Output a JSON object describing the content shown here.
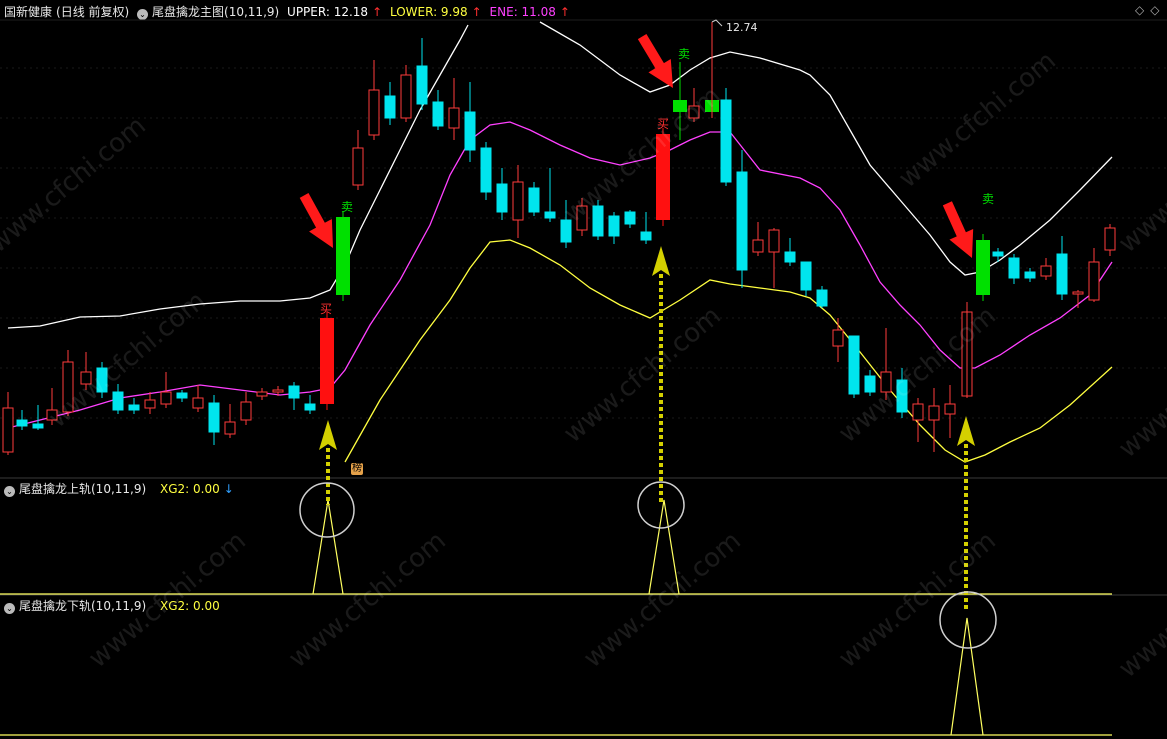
{
  "main_header": {
    "stock_name": "国新健康",
    "period": "(日线 前复权)",
    "indicator_name": "尾盘擒龙主图(10,11,9)",
    "upper_label": "UPPER: 12.18",
    "lower_label": "LOWER: 9.98",
    "ene_label": "ENE: 11.08",
    "upper_color": "#ffffff",
    "lower_color": "#ffff40",
    "ene_color": "#ff40ff"
  },
  "sub1_header": {
    "indicator_name": "尾盘擒龙上轨(10,11,9)",
    "value_label": "XG2: 0.00"
  },
  "sub2_header": {
    "indicator_name": "尾盘擒龙下轨(10,11,9)",
    "value_label": "XG2: 0.00"
  },
  "annotations": {
    "buy_label": "买",
    "sell_label": "卖",
    "high_price_label": "12.74",
    "bang_label": "榜"
  },
  "watermark": "www.cfchi.com",
  "colors": {
    "up_candle": "#ff3b3b",
    "down_candle": "#00e5ee",
    "buy_signal": "#ff1010",
    "sell_signal": "#00e000",
    "arrow_red": "#ff1a1a",
    "arrow_yellow": "#d4d000",
    "signal_line": "#ffff60"
  }
}
